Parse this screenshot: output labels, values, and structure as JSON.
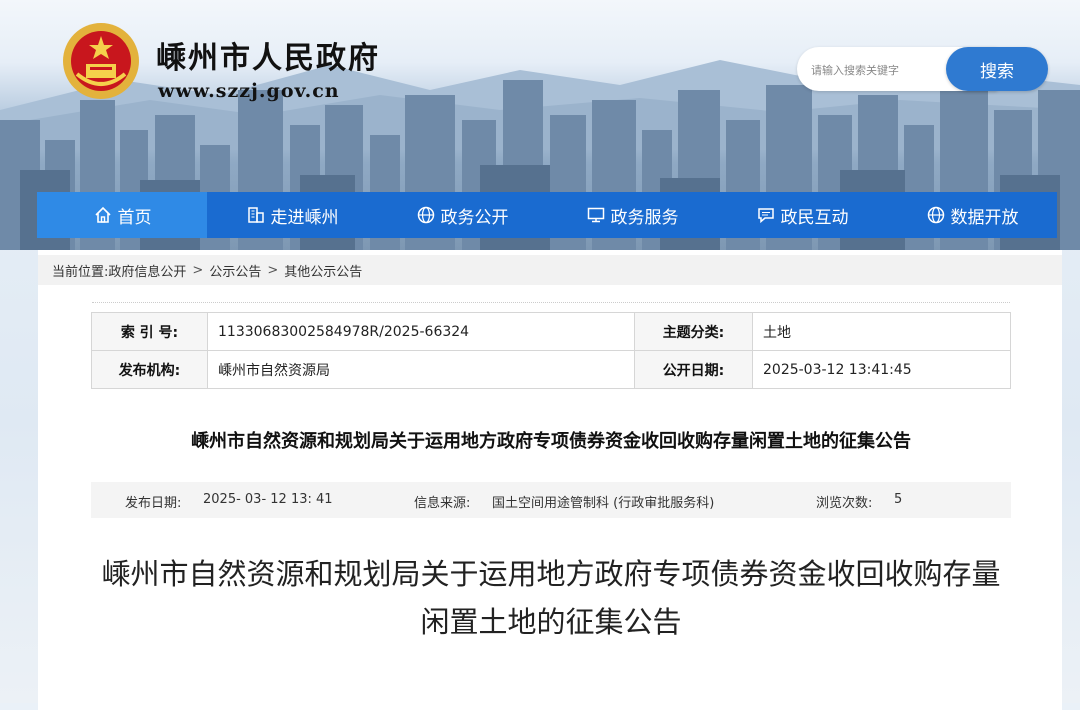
{
  "header": {
    "site_title": "嵊州市人民政府",
    "site_url": "www.szzj.gov.cn",
    "search_placeholder": "请输入搜索关键字",
    "search_button": "搜索",
    "emblem_icon": "national-emblem-icon"
  },
  "nav": {
    "items": [
      {
        "label": "首页",
        "icon": "home-icon"
      },
      {
        "label": "走进嵊州",
        "icon": "building-icon"
      },
      {
        "label": "政务公开",
        "icon": "globe-icon"
      },
      {
        "label": "政务服务",
        "icon": "monitor-icon"
      },
      {
        "label": "政民互动",
        "icon": "chat-icon"
      },
      {
        "label": "数据开放",
        "icon": "globe-icon"
      }
    ],
    "active_color": "#2f8ae6",
    "bar_color": "#1a6bd0"
  },
  "breadcrumb": {
    "prefix": "当前位置:",
    "items": [
      "政府信息公开",
      "公示公告",
      "其他公示公告"
    ],
    "separator": ">"
  },
  "meta": {
    "index_label": "索 引 号:",
    "index_value": "11330683002584978R/2025-66324",
    "topic_label": "主题分类:",
    "topic_value": "土地",
    "publisher_label": "发布机构:",
    "publisher_value": "嵊州市自然资源局",
    "open_date_label": "公开日期:",
    "open_date_value": "2025-03-12 13:41:45"
  },
  "document": {
    "title": "嵊州市自然资源和规划局关于运用地方政府专项债券资金收回收购存量闲置土地的征集公告",
    "publish_date_label": "发布日期:",
    "publish_date_value": "2025- 03- 12 13: 41",
    "source_label": "信息来源:",
    "source_value": "国土空间用途管制科 (行政审批服务科)",
    "views_label": "浏览次数:",
    "views_value": "5",
    "heading_line1": "嵊州市自然资源和规划局关于运用地方政府专项债券资金收回收购存量",
    "heading_line2": "闲置土地的征集公告"
  }
}
